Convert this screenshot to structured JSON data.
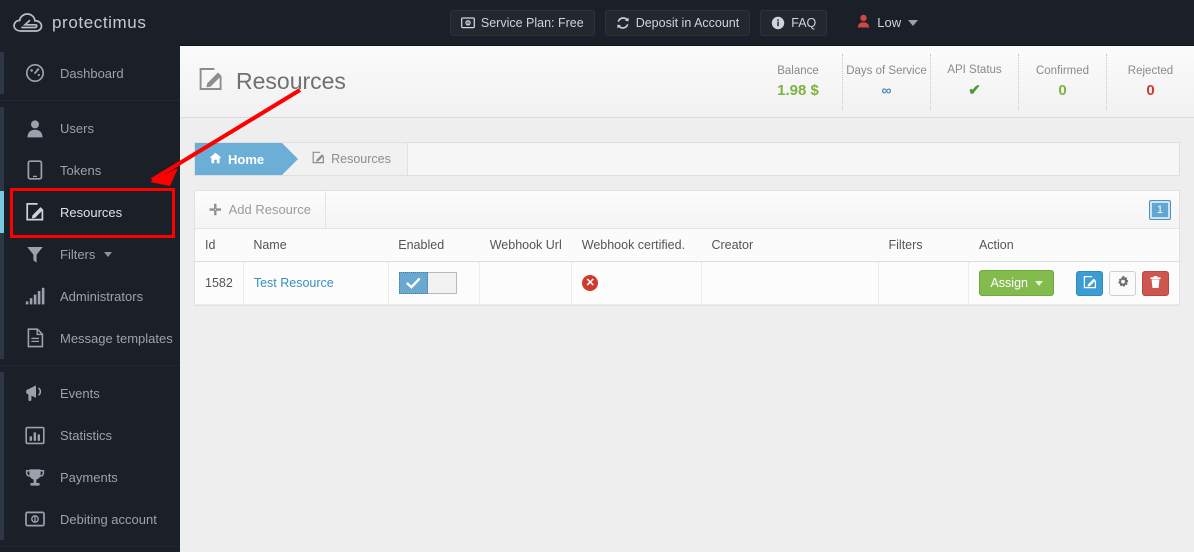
{
  "brand": {
    "name": "protectimus",
    "logo_icon": "cloud-arrow-icon"
  },
  "topbar": {
    "buttons": [
      {
        "label": "Service Plan: Free",
        "icon": "money-bill-icon"
      },
      {
        "label": "Deposit in Account",
        "icon": "refresh-icon"
      },
      {
        "label": "FAQ",
        "icon": "info-circle-icon"
      }
    ],
    "user": {
      "label": "Low",
      "icon": "user-icon",
      "icon_color": "#d0473f",
      "caret": "chevron-down-icon"
    }
  },
  "sidebar": {
    "groups": [
      {
        "items": [
          {
            "label": "Dashboard",
            "icon": "dashboard-gauge-icon",
            "active": false
          }
        ]
      },
      {
        "items": [
          {
            "label": "Users",
            "icon": "user-icon",
            "active": false
          },
          {
            "label": "Tokens",
            "icon": "tablet-icon",
            "active": false
          },
          {
            "label": "Resources",
            "icon": "edit-square-icon",
            "active": true
          },
          {
            "label": "Filters",
            "icon": "funnel-icon",
            "active": false,
            "caret": true
          },
          {
            "label": "Administrators",
            "icon": "bar-chart-icon",
            "active": false
          },
          {
            "label": "Message templates",
            "icon": "document-icon",
            "active": false
          }
        ]
      },
      {
        "items": [
          {
            "label": "Events",
            "icon": "megaphone-icon",
            "active": false
          },
          {
            "label": "Statistics",
            "icon": "chart-box-icon",
            "active": false
          },
          {
            "label": "Payments",
            "icon": "trophy-icon",
            "active": false
          },
          {
            "label": "Debiting account",
            "icon": "money-bill-icon",
            "active": false
          }
        ]
      }
    ]
  },
  "page": {
    "title": "Resources",
    "title_icon": "edit-square-icon",
    "stats": [
      {
        "label": "Balance",
        "value": "1.98 $",
        "style": "green"
      },
      {
        "label": "Days of Service",
        "value": "∞",
        "style": "blue"
      },
      {
        "label": "API Status",
        "value": "✔",
        "style": "ok"
      },
      {
        "label": "Confirmed",
        "value": "0",
        "style": "green"
      },
      {
        "label": "Rejected",
        "value": "0",
        "style": "red"
      }
    ]
  },
  "breadcrumb": {
    "home": {
      "label": "Home",
      "icon": "home-icon"
    },
    "current": {
      "label": "Resources",
      "icon": "edit-square-icon"
    }
  },
  "toolbar": {
    "add_label": "Add Resource",
    "add_icon": "plus-icon",
    "page_badge": "1"
  },
  "table": {
    "headers": [
      "Id",
      "Name",
      "Enabled",
      "Webhook Url",
      "Webhook certified.",
      "Creator",
      "Filters",
      "Action"
    ],
    "rows": [
      {
        "id": "1582",
        "name": "Test Resource",
        "enabled": true,
        "webhook_url": "",
        "webhook_certified": false,
        "webhook_certified_glyph": "✕",
        "creator": "",
        "filters": "",
        "actions": {
          "assign_label": "Assign",
          "edit_icon": "edit-square-icon",
          "settings_icon": "gear-icon",
          "delete_icon": "trash-icon"
        }
      }
    ]
  },
  "colors": {
    "sidebar_bg": "#1b2028",
    "accent_blue": "#6bafd6",
    "active_marker": "#79c7e0",
    "green": "#7cb342",
    "red": "#cc3b33",
    "annotation": "#ff0000"
  },
  "annotations": {
    "highlight_target": "sidebar-item-resources",
    "arrow": "red-arrow-pointing-to-resources"
  }
}
